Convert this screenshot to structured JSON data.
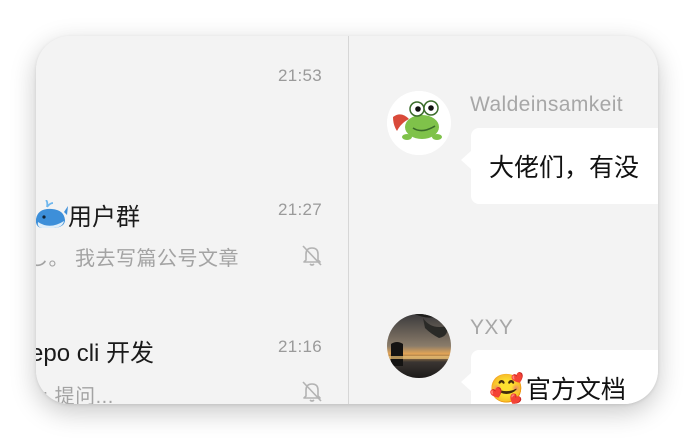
{
  "chat_list": {
    "items": [
      {
        "time": "21:53"
      },
      {
        "title": "用户群",
        "icon": "whale-icon",
        "time": "21:27",
        "preview": "し。 我去写篇公号文章",
        "muted": true
      },
      {
        "title": "epo cli 开发",
        "time": "21:16",
        "preview": "y: 提问...",
        "muted": true
      }
    ]
  },
  "chat": {
    "messages": [
      {
        "sender": "Waldeinsamkeit",
        "text": "大佬们，有没"
      },
      {
        "sender": "YXY",
        "emoji": "🥰",
        "text": "官方文档"
      }
    ]
  }
}
